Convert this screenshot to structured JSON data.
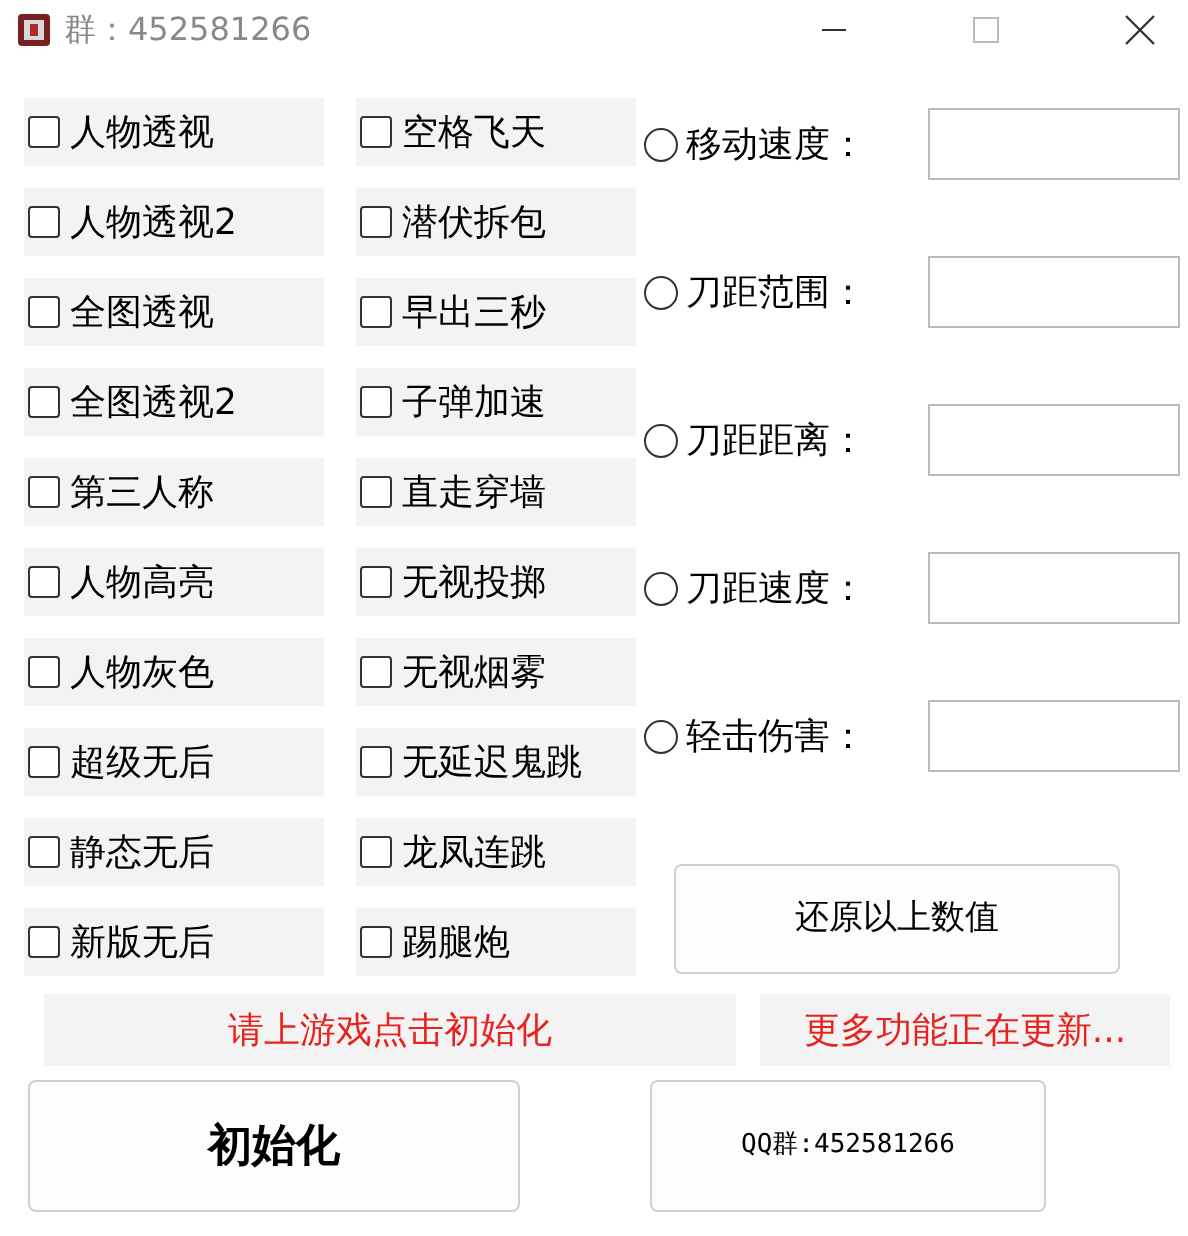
{
  "window": {
    "title": "群：452581266"
  },
  "checkboxes_column_1": [
    {
      "label": "人物透视",
      "checked": false
    },
    {
      "label": "人物透视2",
      "checked": false
    },
    {
      "label": "全图透视",
      "checked": false
    },
    {
      "label": "全图透视2",
      "checked": false
    },
    {
      "label": "第三人称",
      "checked": false
    },
    {
      "label": "人物高亮",
      "checked": false
    },
    {
      "label": "人物灰色",
      "checked": false
    },
    {
      "label": "超级无后",
      "checked": false
    },
    {
      "label": "静态无后",
      "checked": false
    },
    {
      "label": "新版无后",
      "checked": false
    }
  ],
  "checkboxes_column_2": [
    {
      "label": "空格飞天",
      "checked": false
    },
    {
      "label": "潜伏拆包",
      "checked": false
    },
    {
      "label": "早出三秒",
      "checked": false
    },
    {
      "label": "子弹加速",
      "checked": false
    },
    {
      "label": "直走穿墙",
      "checked": false
    },
    {
      "label": "无视投掷",
      "checked": false
    },
    {
      "label": "无视烟雾",
      "checked": false
    },
    {
      "label": "无延迟鬼跳",
      "checked": false
    },
    {
      "label": "龙凤连跳",
      "checked": false
    },
    {
      "label": "踢腿炮",
      "checked": false
    }
  ],
  "radio_settings": [
    {
      "label": "移动速度：",
      "selected": false
    },
    {
      "label": "刀距范围：",
      "selected": false
    },
    {
      "label": "刀距距离：",
      "selected": false
    },
    {
      "label": "刀距速度：",
      "selected": false
    },
    {
      "label": "轻击伤害：",
      "selected": false
    }
  ],
  "restore_button": "还原以上数值",
  "status_left": "请上游戏点击初始化",
  "status_right": "更多功能正在更新...",
  "init_button": "初始化",
  "qq_button": "QQ群:452581266"
}
